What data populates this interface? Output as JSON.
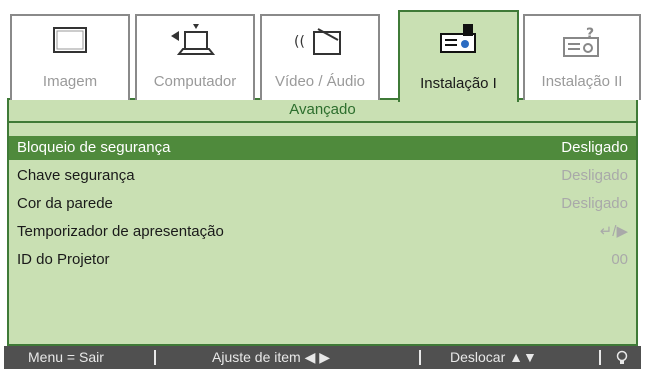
{
  "tabs": [
    {
      "label": "Imagem",
      "icon": "monitor-icon",
      "active": false
    },
    {
      "label": "Computador",
      "icon": "computer-icon",
      "active": false
    },
    {
      "label": "Vídeo / Áudio",
      "icon": "video-audio-icon",
      "active": false
    },
    {
      "label": "Instalação I",
      "icon": "projector-icon",
      "active": true
    },
    {
      "label": "Instalação II",
      "icon": "projector-settings-icon",
      "active": false
    }
  ],
  "subtitle": "Avançado",
  "items": [
    {
      "name": "Bloqueio de segurança",
      "value": "Desligado",
      "selected": true
    },
    {
      "name": "Chave segurança",
      "value": "Desligado",
      "selected": false
    },
    {
      "name": "Cor da parede",
      "value": "Desligado",
      "selected": false
    },
    {
      "name": "Temporizador de apresentação",
      "value": "↵/▶",
      "selected": false
    },
    {
      "name": "ID do Projetor",
      "value": "00",
      "selected": false
    }
  ],
  "footer": {
    "menu": "Menu = Sair",
    "adjust": "Ajuste de item ◀ ▶",
    "move": "Deslocar ▲▼",
    "icon": "lightbulb-icon"
  },
  "colors": {
    "accent": "#4f8a3c",
    "panel": "#c9e0b3",
    "frame": "#3f7a37",
    "footer": "#505050"
  }
}
